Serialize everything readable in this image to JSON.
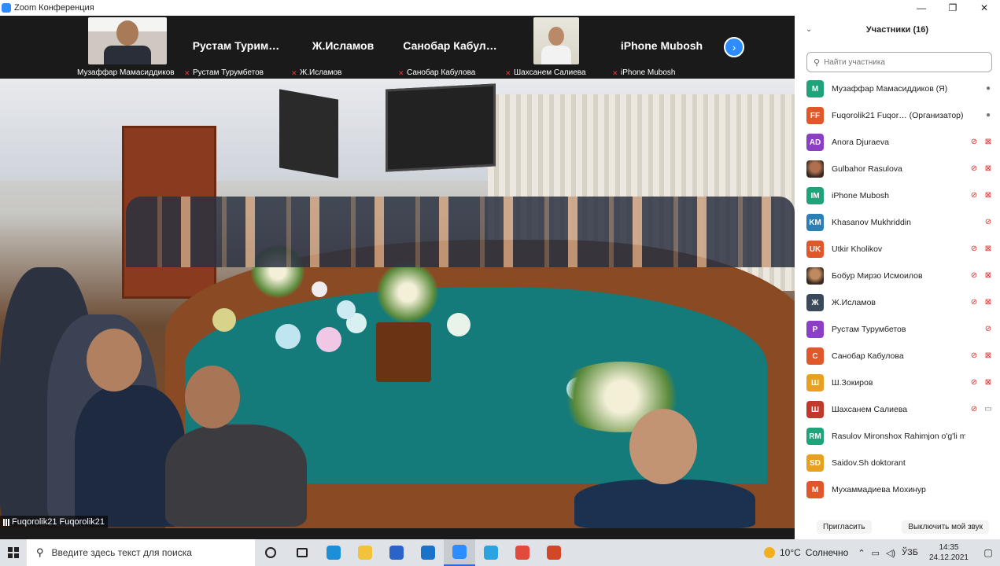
{
  "app": {
    "title": "Zoom Конференция"
  },
  "window_controls": {
    "minimize": "—",
    "restore": "❐",
    "close": "✕"
  },
  "strip": {
    "tiles": [
      {
        "name": "",
        "label": "Музаффар Мамасиддиков",
        "muted": false,
        "has_photo": true
      },
      {
        "name": "Рустам Турим…",
        "label": "Рустам Турумбетов",
        "muted": true
      },
      {
        "name": "Ж.Исламов",
        "label": "Ж.Исламов",
        "muted": true
      },
      {
        "name": "Санобар Кабул…",
        "label": "Санобар Кабулова",
        "muted": true
      },
      {
        "name": "",
        "label": "Шахсанем Салиева",
        "muted": true,
        "has_photo": true
      },
      {
        "name": "iPhone Mubosh",
        "label": "iPhone Mubosh",
        "muted": true
      }
    ],
    "next_icon": "›"
  },
  "main_video": {
    "label": "Fuqorolik21 Fuqorolik21"
  },
  "participants": {
    "title": "Участники (16)",
    "search_placeholder": "Найти участника",
    "list": [
      {
        "initials": "M",
        "color": "#1fa37b",
        "name": "Музаффар Мамасиддиков (Я)",
        "mic": "on",
        "video": "none"
      },
      {
        "initials": "FF",
        "color": "#e0572a",
        "name": "Fuqorolik21 Fuqor…  (Организатор)",
        "mic": "on",
        "video": "none"
      },
      {
        "initials": "AD",
        "color": "#8a3fc4",
        "name": "Anora Djuraeva",
        "mic": "off",
        "video": "off"
      },
      {
        "initials": "",
        "color": "#b07050",
        "name": "Gulbahor Rasulova",
        "mic": "off",
        "video": "off",
        "photo": true
      },
      {
        "initials": "IM",
        "color": "#1fa37b",
        "name": "iPhone Mubosh",
        "mic": "off",
        "video": "off"
      },
      {
        "initials": "KM",
        "color": "#2b7fb5",
        "name": "Khasanov Mukhriddin",
        "mic": "off",
        "video": "none"
      },
      {
        "initials": "UK",
        "color": "#e0572a",
        "name": "Utkir Kholikov",
        "mic": "off",
        "video": "off"
      },
      {
        "initials": "",
        "color": "#c08a60",
        "name": "Бобур Мирзо Исмоилов",
        "mic": "off",
        "video": "off",
        "photo": true
      },
      {
        "initials": "Ж",
        "color": "#3a4a5a",
        "name": "Ж.Исламов",
        "mic": "off",
        "video": "off"
      },
      {
        "initials": "P",
        "color": "#8a3fc4",
        "name": "Рустам Турумбетов",
        "mic": "off",
        "video": "none"
      },
      {
        "initials": "C",
        "color": "#e0572a",
        "name": "Санобар Кабулова",
        "mic": "off",
        "video": "off"
      },
      {
        "initials": "Ш",
        "color": "#e8a020",
        "name": "Ш.Зокиров",
        "mic": "off",
        "video": "off"
      },
      {
        "initials": "Ш",
        "color": "#c0392b",
        "name": "Шахсанем Салиева",
        "mic": "off",
        "video": "on"
      },
      {
        "initials": "RM",
        "color": "#1fa37b",
        "name": "Rasulov Mironshox Rahimjon o'g'li mustaqi…",
        "mic": "none",
        "video": "none"
      },
      {
        "initials": "SD",
        "color": "#e8a020",
        "name": "Saidov.Sh doktorant",
        "mic": "none",
        "video": "none"
      },
      {
        "initials": "M",
        "color": "#e0572a",
        "name": "Мухаммадиева Мохинур",
        "mic": "none",
        "video": "none"
      }
    ],
    "invite_label": "Пригласить",
    "mute_all_label": "Выключить мой звук"
  },
  "taskbar": {
    "search_text": "Введите здесь текст для поиска",
    "weather_temp": "10°C",
    "weather_text": "Солнечно",
    "lang": "ЎЗБ",
    "time": "14:35",
    "date": "24.12.2021",
    "apps": [
      {
        "name": "cortana-icon",
        "color": "transparent"
      },
      {
        "name": "task-view-icon",
        "color": "transparent"
      },
      {
        "name": "edge-icon",
        "color": "#1d8fd8"
      },
      {
        "name": "file-explorer-icon",
        "color": "#f1c23a"
      },
      {
        "name": "store-icon",
        "color": "#2a63c9"
      },
      {
        "name": "mail-icon",
        "color": "#1a73c8"
      },
      {
        "name": "zoom-icon",
        "color": "#2d8cff"
      },
      {
        "name": "telegram-icon",
        "color": "#2aa3e0"
      },
      {
        "name": "chrome-icon",
        "color": "#e24a3b"
      },
      {
        "name": "powerpoint-icon",
        "color": "#d24726"
      }
    ]
  }
}
